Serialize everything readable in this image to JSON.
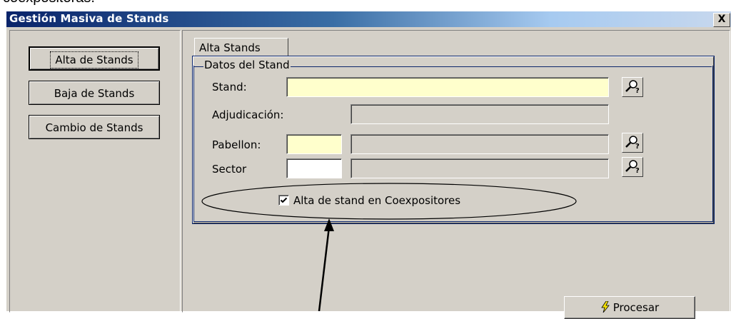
{
  "caption": {
    "text": "coexpositoras."
  },
  "window": {
    "title": "Gestión Masiva de Stands",
    "close_label": "X"
  },
  "sidebar": {
    "items": [
      {
        "label": "Alta de Stands",
        "active": true
      },
      {
        "label": "Baja de Stands",
        "active": false
      },
      {
        "label": "Cambio de Stands",
        "active": false
      }
    ]
  },
  "tab": {
    "label": "Alta Stands"
  },
  "group": {
    "title": "Datos del Stand"
  },
  "form": {
    "stand_label": "Stand:",
    "stand_value": "",
    "adjudicacion_label": "Adjudicación:",
    "adjudicacion_value": "",
    "pabellon_label": "Pabellon:",
    "pabellon_code": "",
    "pabellon_desc": "",
    "sector_label": "Sector",
    "sector_code": "",
    "sector_desc": ""
  },
  "checkbox": {
    "label": "Alta de stand en Coexpositores",
    "checked": true
  },
  "actions": {
    "procesar_label": "Procesar"
  },
  "icons": {
    "lookup": "search-help-icon",
    "procesar": "lightning-icon"
  },
  "colors": {
    "title_bar": "#0a246a",
    "face": "#d4d0c8",
    "required_field": "#ffffcc"
  }
}
